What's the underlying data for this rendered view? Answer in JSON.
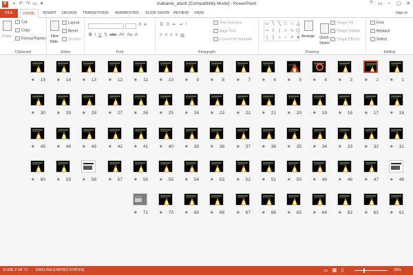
{
  "window": {
    "title": "mabanie_atash [Compatibility Mode] - PowerPoint",
    "app_icon": "P",
    "controls": [
      "?",
      "▭",
      "–",
      "▢",
      "✕"
    ]
  },
  "qat": {
    "icons": [
      "save-icon",
      "undo-icon",
      "redo-icon",
      "present-icon",
      "customize-icon"
    ]
  },
  "tabs": [
    "FILE",
    "HOME",
    "INSERT",
    "DESIGN",
    "TRANSITIONS",
    "ANIMATIONS",
    "SLIDE SHOW",
    "REVIEW",
    "VIEW"
  ],
  "signin": "Sign in",
  "ribbon": {
    "clipboard": {
      "label": "Clipboard",
      "paste": "Paste",
      "cut": "Cut",
      "copy": "Copy",
      "format_painter": "Format Painter"
    },
    "slides": {
      "label": "Slides",
      "new_slide": "New",
      "new_slide2": "Slide",
      "layout": "Layout",
      "reset": "Reset",
      "section": "Section"
    },
    "font": {
      "label": "Font"
    },
    "paragraph": {
      "label": "Paragraph",
      "text_direction": "Text Direction",
      "align_text": "Align Text",
      "smartart": "Convert to SmartArt"
    },
    "drawing": {
      "label": "Drawing",
      "arrange": "Arrange",
      "quick_styles": "Quick",
      "quick_styles2": "Styles",
      "shape_fill": "Shape Fill",
      "shape_outline": "Shape Outline",
      "shape_effects": "Shape Effects"
    },
    "editing": {
      "label": "Editing",
      "find": "Find",
      "replace": "Replace",
      "select": "Select"
    }
  },
  "slides": {
    "selected": 2,
    "rows": [
      [
        15,
        14,
        13,
        12,
        11,
        10,
        9,
        8,
        7,
        6,
        5,
        4,
        3,
        2,
        1
      ],
      [
        30,
        29,
        28,
        27,
        26,
        25,
        24,
        23,
        22,
        21,
        20,
        19,
        18,
        17,
        16
      ],
      [
        45,
        44,
        43,
        42,
        41,
        40,
        39,
        38,
        37,
        36,
        35,
        34,
        33,
        32,
        31
      ],
      [
        60,
        59,
        58,
        57,
        56,
        55,
        54,
        53,
        52,
        51,
        50,
        49,
        48,
        47,
        46
      ],
      [
        71,
        70,
        69,
        68,
        67,
        66,
        65,
        64,
        63,
        62,
        61
      ]
    ],
    "star": "∗"
  },
  "status": {
    "slide_of": "SLIDE 2 OF 71",
    "language": "ENGLISH (UNITED STATES)",
    "zoom": "20%"
  },
  "colors": {
    "accent": "#d24726"
  }
}
